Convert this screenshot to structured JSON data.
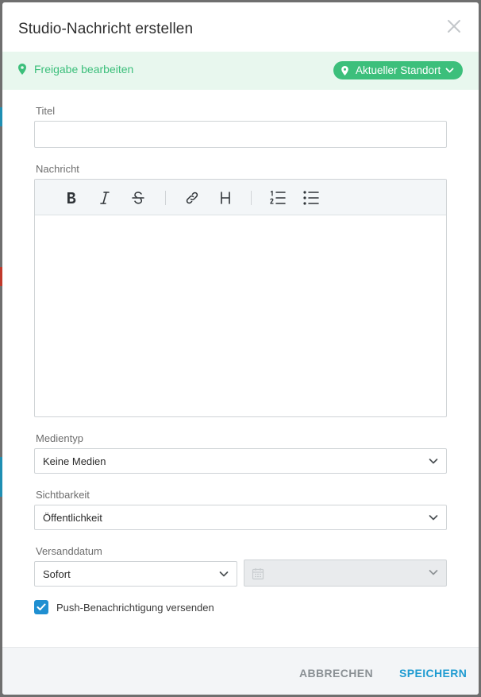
{
  "dialog": {
    "title": "Studio-Nachricht erstellen",
    "close_icon": "close-icon"
  },
  "share_bar": {
    "edit_link": "Freigabe bearbeiten",
    "location_button": "Aktueller Standort",
    "accent_color": "#3cbf7b"
  },
  "form": {
    "title_label": "Titel",
    "title_value": "",
    "message_label": "Nachricht",
    "toolbar_icons": [
      "bold-icon",
      "italic-icon",
      "strikethrough-icon",
      "link-icon",
      "heading-icon",
      "ordered-list-icon",
      "bullet-list-icon"
    ],
    "media_label": "Medientyp",
    "media_value": "Keine Medien",
    "visibility_label": "Sichtbarkeit",
    "visibility_value": "Öffentlichkeit",
    "send_date_label": "Versanddatum",
    "send_date_value": "Sofort",
    "date_picker_value": "",
    "push_label": "Push-Benachrichtigung versenden",
    "push_checked": true
  },
  "footer": {
    "cancel_label": "ABBRECHEN",
    "save_label": "SPEICHERN",
    "primary_color": "#1f9bd1"
  }
}
